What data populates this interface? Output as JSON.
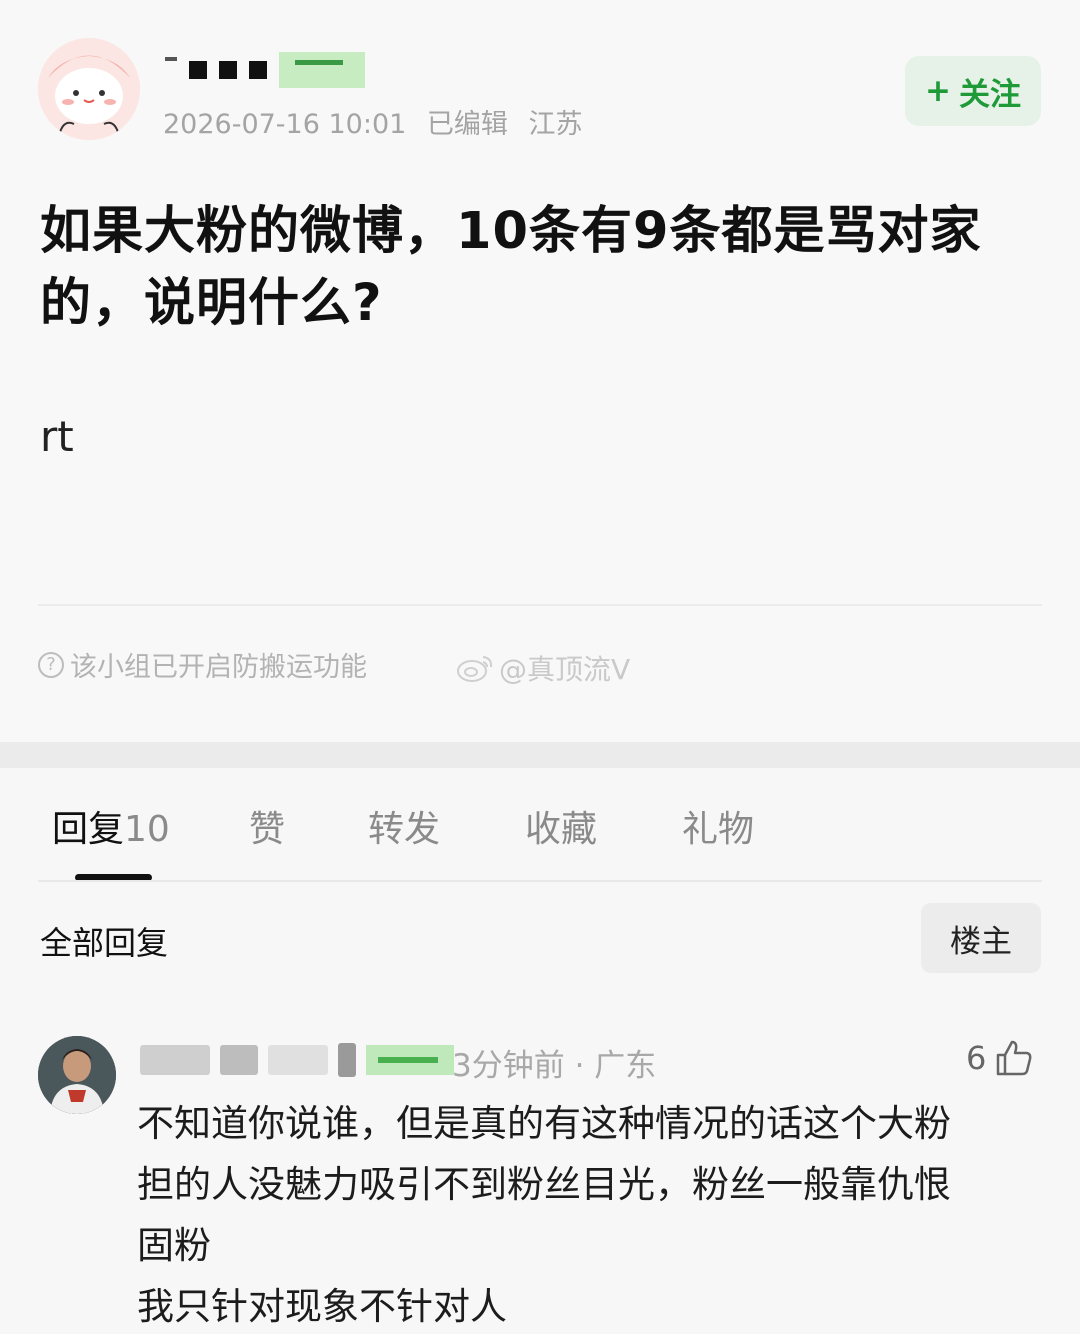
{
  "post": {
    "meta_time": "2026-07-16 10:01",
    "meta_edited": "已编辑",
    "meta_location": "江苏",
    "follow_plus": "+",
    "follow_label": "关注",
    "title": "如果大粉的微博，10条有9条都是骂对家的，说明什么?",
    "body": "rt",
    "notice": "该小组已开启防搬运功能",
    "watermark": "@真顶流V"
  },
  "tabs": [
    {
      "label": "回复",
      "count": "10"
    },
    {
      "label": "赞"
    },
    {
      "label": "转发"
    },
    {
      "label": "收藏"
    },
    {
      "label": "礼物"
    }
  ],
  "comments_section": {
    "title": "全部回复",
    "op_filter": "楼主"
  },
  "comment": {
    "meta": "3分钟前 · 广东",
    "likes": "6",
    "lines": [
      "不知道你说谁，但是真的有这种情况的话这个大粉",
      "担的人没魅力吸引不到粉丝目光，粉丝一般靠仇恨",
      "固粉",
      "我只针对现象不针对人"
    ]
  },
  "colors": {
    "accent_green": "#1f9a39",
    "follow_bg": "#e6f2e7",
    "meta_gray": "#a4a4a4"
  },
  "icons": [
    "help-circle-icon",
    "weibo-logo-icon",
    "thumbs-up-icon",
    "user-avatar-icon"
  ]
}
